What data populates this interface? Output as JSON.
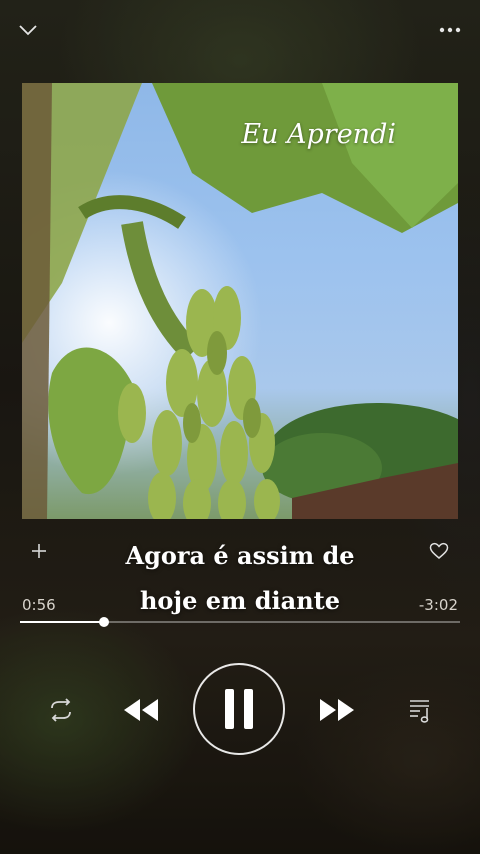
{
  "player": {
    "art_title": "Eu Aprendi",
    "lyrics_line1": "Agora é assim de",
    "lyrics_line2": "hoje em diante",
    "elapsed": "0:56",
    "remaining": "-3:02",
    "progress_fraction": 0.19
  },
  "icons": {
    "collapse": "chevron-down-icon",
    "more": "more-horizontal-icon",
    "add": "plus-icon",
    "like": "heart-icon",
    "repeat": "repeat-icon",
    "previous": "rewind-icon",
    "pause": "pause-icon",
    "next": "fast-forward-icon",
    "queue": "playlist-queue-icon"
  },
  "colors": {
    "accent": "#ffffff",
    "sky": "#9cc2ee",
    "leaf": "#6f9a3a"
  }
}
